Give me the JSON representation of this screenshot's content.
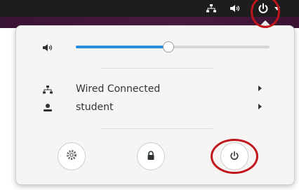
{
  "top_bar": {
    "tray_icons": [
      "network-wired-icon",
      "volume-icon",
      "power-icon",
      "chevron-down-icon"
    ]
  },
  "menu": {
    "volume": {
      "icon": "volume-icon",
      "level": 0.48
    },
    "items": [
      {
        "label": "Wired Connected",
        "icon": "network-wired-icon",
        "has_submenu": true
      },
      {
        "label": "student",
        "icon": "user-icon",
        "has_submenu": true
      }
    ],
    "actions": [
      {
        "icon": "settings-icon"
      },
      {
        "icon": "lock-icon"
      },
      {
        "icon": "power-icon"
      }
    ]
  },
  "colors": {
    "accent": "#2a8fe0",
    "annotation": "#c0161b",
    "top_bar": "#1d1d1d",
    "menu_bg": "#f6f5f4"
  }
}
